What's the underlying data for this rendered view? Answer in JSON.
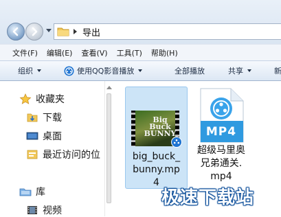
{
  "address_bar": {
    "path_segment": "导出"
  },
  "menu": {
    "items": [
      "文件(F)",
      "编辑(E)",
      "查看(V)",
      "工具(T)",
      "帮助(H)"
    ]
  },
  "toolbar": {
    "organize": "组织",
    "play_with_qq": "使用QQ影音播放",
    "play_all": "全部播放",
    "share": "共享",
    "new": "新"
  },
  "sidebar": {
    "favorites": "收藏夹",
    "items": [
      "下载",
      "桌面",
      "最近访问的位"
    ],
    "libraries": "库",
    "library_items": [
      "视频"
    ]
  },
  "files": [
    {
      "name_lines": [
        "big_buck_",
        "bunny.mp",
        "4"
      ],
      "thumbnail_text": [
        "Big Buck",
        "BUNNY"
      ],
      "selected": true
    },
    {
      "name_lines": [
        "超级马里奥",
        "兄弟通关.",
        "mp4"
      ],
      "type_label": "MP4",
      "selected": false
    }
  ],
  "watermark": "极速下载站",
  "colors": {
    "selection_bg": "#cce4f7",
    "mp4_blue": "#2f9ae0",
    "watermark_outline": "#0b4d99"
  }
}
